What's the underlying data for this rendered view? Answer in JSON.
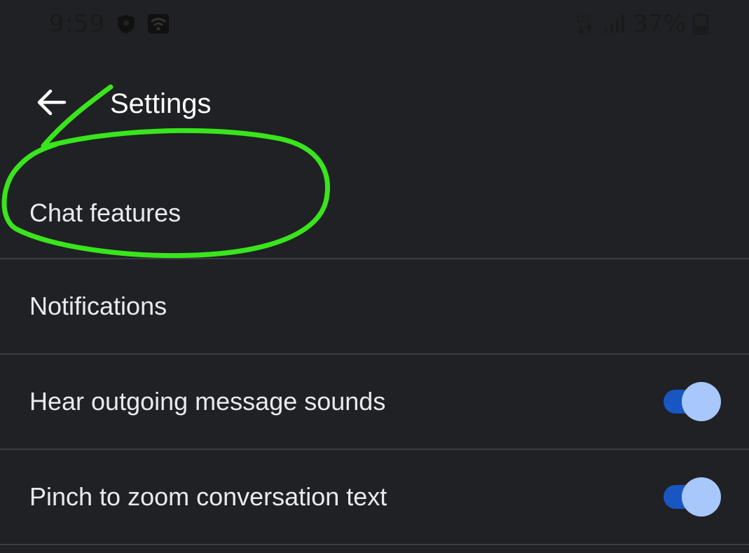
{
  "status_bar": {
    "time": "9:59",
    "battery_percent": "37%",
    "network_label": "LTE",
    "icons": [
      "shield-icon",
      "wifi-hotspot-icon",
      "lte-icon",
      "signal-icon",
      "battery-icon"
    ]
  },
  "toolbar": {
    "back_icon": "arrow-back-icon",
    "title": "Settings"
  },
  "settings": {
    "items": [
      {
        "label": "Chat features",
        "has_toggle": false
      },
      {
        "label": "Notifications",
        "has_toggle": false
      },
      {
        "label": "Hear outgoing message sounds",
        "has_toggle": true,
        "toggle_on": true
      },
      {
        "label": "Pinch to zoom conversation text",
        "has_toggle": true,
        "toggle_on": true
      }
    ]
  },
  "colors": {
    "background": "#202124",
    "text": "#e8eaed",
    "divider": "#3c3d40",
    "toggle_track": "#1a56c2",
    "toggle_thumb": "#a8c7fa",
    "annotation": "#39e51c"
  }
}
